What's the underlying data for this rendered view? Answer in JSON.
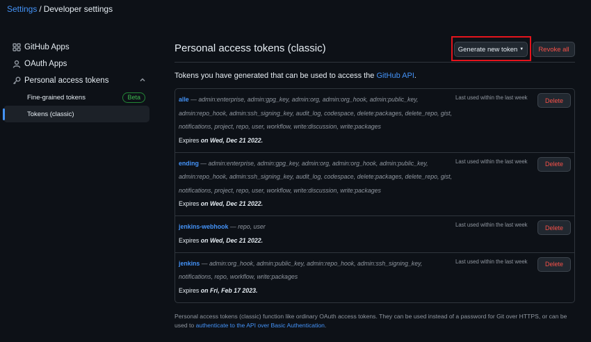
{
  "breadcrumb": {
    "parent": "Settings",
    "separator": "/",
    "current": "Developer settings"
  },
  "sidebar": {
    "items": [
      {
        "label": "GitHub Apps",
        "icon": "apps-icon"
      },
      {
        "label": "OAuth Apps",
        "icon": "person-icon"
      },
      {
        "label": "Personal access tokens",
        "icon": "key-icon"
      }
    ],
    "sub_items": [
      {
        "label": "Fine-grained tokens",
        "badge": "Beta"
      },
      {
        "label": "Tokens (classic)"
      }
    ]
  },
  "main": {
    "title": "Personal access tokens (classic)",
    "generate_label": "Generate new token",
    "revoke_label": "Revoke all",
    "intro_text": "Tokens you have generated that can be used to access the ",
    "intro_link": "GitHub API",
    "intro_end": ".",
    "delete_label": "Delete",
    "last_used": "Last used within the last week",
    "expires_prefix": "Expires ",
    "tokens": [
      {
        "name": "alle",
        "scopes": "admin:enterprise, admin:gpg_key, admin:org, admin:org_hook, admin:public_key, admin:repo_hook, admin:ssh_signing_key, audit_log, codespace, delete:packages, delete_repo, gist, notifications, project, repo, user, workflow, write:discussion, write:packages",
        "expires": "on Wed, Dec 21 2022."
      },
      {
        "name": "ending",
        "scopes": "admin:enterprise, admin:gpg_key, admin:org, admin:org_hook, admin:public_key, admin:repo_hook, admin:ssh_signing_key, audit_log, codespace, delete:packages, delete_repo, gist, notifications, project, repo, user, workflow, write:discussion, write:packages",
        "expires": "on Wed, Dec 21 2022."
      },
      {
        "name": "jenkins-webhook",
        "scopes": "repo, user",
        "expires": "on Wed, Dec 21 2022."
      },
      {
        "name": "jenkins",
        "scopes": "admin:org_hook, admin:public_key, admin:repo_hook, admin:ssh_signing_key, notifications, repo, workflow, write:packages",
        "expires": "on Fri, Feb 17 2023."
      }
    ],
    "footer_text": "Personal access tokens (classic) function like ordinary OAuth access tokens. They can be used instead of a password for Git over HTTPS, or can be used to ",
    "footer_link": "authenticate to the API over Basic Authentication",
    "footer_end": "."
  },
  "colors": {
    "background": "#0d1117",
    "link": "#4493f8",
    "danger": "#f85149",
    "highlight": "#e5141c",
    "beta": "#3fb950"
  }
}
